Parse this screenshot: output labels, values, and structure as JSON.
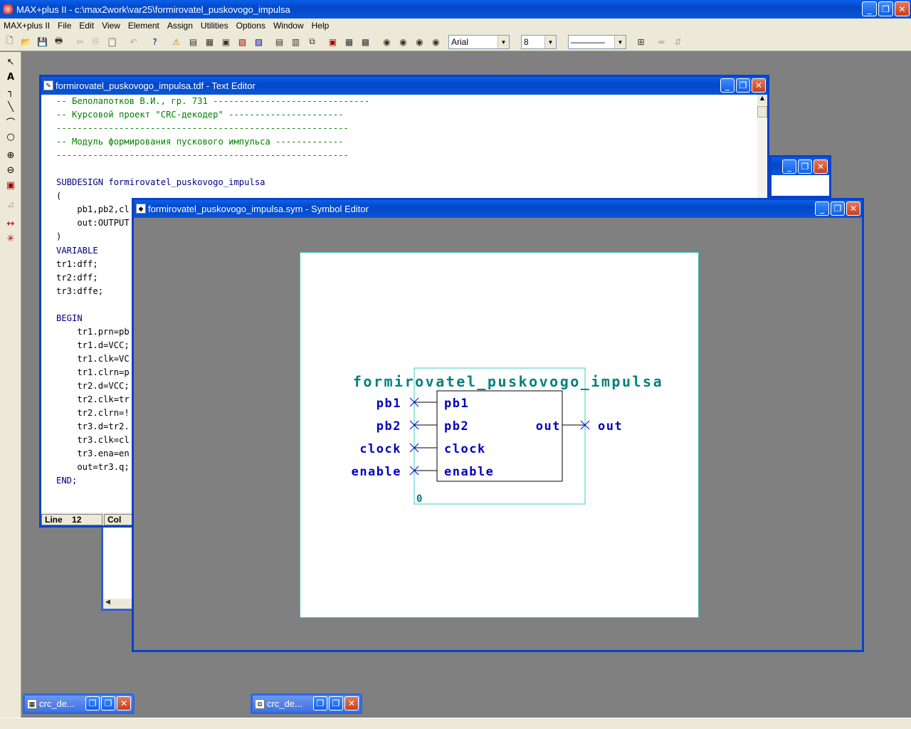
{
  "app": {
    "title": "MAX+plus II - c:\\max2work\\var25\\formirovatel_puskovogo_impulsa",
    "min_label": "_",
    "restore_label": "❐",
    "close_label": "✕"
  },
  "menu": [
    "MAX+plus II",
    "File",
    "Edit",
    "View",
    "Element",
    "Assign",
    "Utilities",
    "Options",
    "Window",
    "Help"
  ],
  "toolbar": {
    "font_name": "Arial",
    "font_size": "8",
    "line_style": "————"
  },
  "text_editor": {
    "title": "formirovatel_puskovogo_impulsa.tdf - Text Editor",
    "status_line_label": "Line",
    "status_line_value": "12",
    "status_col_label": "Col",
    "lines": [
      {
        "cls": "c",
        "text": "-- Белолапотков В.И., гр. 731 ------------------------------"
      },
      {
        "cls": "c",
        "text": "-- Курсовой проект \"CRC-декодер\" ----------------------"
      },
      {
        "cls": "c",
        "text": "--------------------------------------------------------"
      },
      {
        "cls": "c",
        "text": "-- Модуль формирования пускового импульса -------------"
      },
      {
        "cls": "c",
        "text": "--------------------------------------------------------"
      },
      {
        "cls": "",
        "text": ""
      },
      {
        "cls": "k",
        "text": "SUBDESIGN formirovatel_puskovogo_impulsa"
      },
      {
        "cls": "",
        "text": "("
      },
      {
        "cls": "",
        "text": "    pb1,pb2,cl"
      },
      {
        "cls": "",
        "text": "    out:OUTPUT"
      },
      {
        "cls": "",
        "text": ")"
      },
      {
        "cls": "k",
        "text": "VARIABLE"
      },
      {
        "cls": "",
        "text": "tr1:dff;"
      },
      {
        "cls": "",
        "text": "tr2:dff;"
      },
      {
        "cls": "",
        "text": "tr3:dffe;"
      },
      {
        "cls": "",
        "text": ""
      },
      {
        "cls": "k",
        "text": "BEGIN"
      },
      {
        "cls": "",
        "text": "    tr1.prn=pb"
      },
      {
        "cls": "",
        "text": "    tr1.d=VCC;"
      },
      {
        "cls": "",
        "text": "    tr1.clk=VC"
      },
      {
        "cls": "",
        "text": "    tr1.clrn=p"
      },
      {
        "cls": "",
        "text": "    tr2.d=VCC;"
      },
      {
        "cls": "",
        "text": "    tr2.clk=tr"
      },
      {
        "cls": "",
        "text": "    tr2.clrn=!"
      },
      {
        "cls": "",
        "text": "    tr3.d=tr2."
      },
      {
        "cls": "",
        "text": "    tr3.clk=cl"
      },
      {
        "cls": "",
        "text": "    tr3.ena=en"
      },
      {
        "cls": "",
        "text": "    out=tr3.q;"
      },
      {
        "cls": "k",
        "text": "END;"
      }
    ]
  },
  "symbol_editor": {
    "title": "formirovatel_puskovogo_impulsa.sym - Symbol Editor",
    "symbol_name": "formirovatel_puskovogo_impulsa",
    "instance_number": "0",
    "inputs": [
      "pb1",
      "pb2",
      "clock",
      "enable"
    ],
    "outputs": [
      "out"
    ]
  },
  "minimized": [
    {
      "title": "crc_de..."
    },
    {
      "title": "crc_de..."
    }
  ]
}
